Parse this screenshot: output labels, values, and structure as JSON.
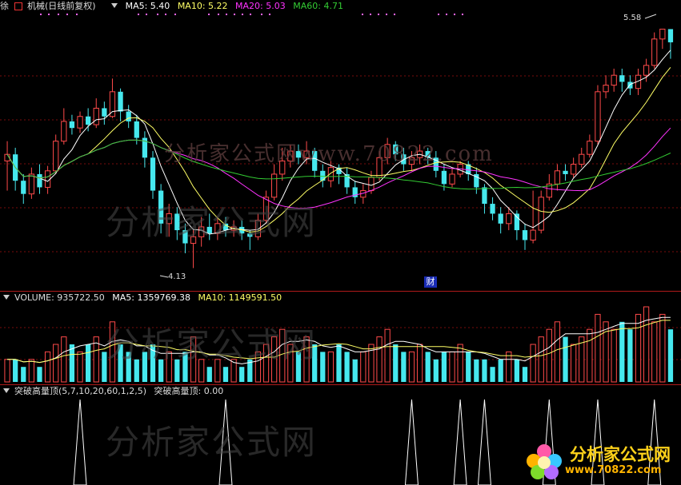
{
  "colors": {
    "up": "#ff4a4a",
    "down": "#46e8ee",
    "ma5": "#ffffff",
    "ma10": "#ffff66",
    "ma20": "#ff33ff",
    "ma60": "#33cc33",
    "grid": "#7a0d0d",
    "separator": "#b01a1a"
  },
  "price_panel": {
    "stock_name_pre": "徐",
    "stock_name_post": "机械(日线前复权)",
    "ma5": "MA5: 5.40",
    "ma10": "MA10: 5.22",
    "ma20": "MA20: 5.03",
    "ma60": "MA60: 4.71",
    "high_marker": "5.58",
    "low_marker": "4.13",
    "event_badge": "财"
  },
  "volume_panel": {
    "volume": "VOLUME: 935722.50",
    "ma5": "MA5: 1359769.38",
    "ma10": "MA10: 1149591.50"
  },
  "indicator_panel": {
    "formula": "突破高量顶(5,7,10,20,60,1,2,5)",
    "value": "突破高量顶: 0.00"
  },
  "watermarks": {
    "site_cn": "分析家公式网",
    "site_url_top": "分析家公式网www.70822.com",
    "logo_cn": "分析家公式网",
    "logo_url": "www.70822.com"
  },
  "chart_data": {
    "type": "candlestick",
    "price_axis_note": "low 4.13, high 5.58",
    "candles": [
      [
        4.78,
        4.82,
        4.6,
        4.9
      ],
      [
        4.82,
        4.66,
        4.6,
        4.86
      ],
      [
        4.66,
        4.58,
        4.52,
        4.7
      ],
      [
        4.58,
        4.7,
        4.55,
        4.74
      ],
      [
        4.7,
        4.62,
        4.58,
        4.76
      ],
      [
        4.62,
        4.72,
        4.58,
        4.75
      ],
      [
        4.72,
        4.9,
        4.7,
        4.94
      ],
      [
        4.9,
        5.02,
        4.88,
        5.1
      ],
      [
        5.02,
        4.98,
        4.94,
        5.06
      ],
      [
        4.98,
        5.05,
        4.95,
        5.08
      ],
      [
        5.05,
        5.0,
        4.96,
        5.1
      ],
      [
        5.0,
        5.1,
        4.98,
        5.16
      ],
      [
        5.1,
        5.05,
        5.0,
        5.14
      ],
      [
        5.05,
        5.2,
        5.04,
        5.28
      ],
      [
        5.2,
        5.08,
        5.02,
        5.22
      ],
      [
        5.08,
        5.02,
        4.98,
        5.12
      ],
      [
        5.02,
        4.92,
        4.88,
        5.06
      ],
      [
        4.92,
        4.8,
        4.74,
        4.96
      ],
      [
        4.8,
        4.6,
        4.55,
        4.84
      ],
      [
        4.6,
        4.4,
        4.34,
        4.64
      ],
      [
        4.4,
        4.46,
        4.32,
        4.52
      ],
      [
        4.46,
        4.36,
        4.3,
        4.5
      ],
      [
        4.36,
        4.28,
        4.22,
        4.4
      ],
      [
        4.28,
        4.32,
        4.13,
        4.36
      ],
      [
        4.32,
        4.38,
        4.26,
        4.44
      ],
      [
        4.38,
        4.34,
        4.3,
        4.46
      ],
      [
        4.34,
        4.4,
        4.3,
        4.44
      ],
      [
        4.4,
        4.36,
        4.32,
        4.44
      ],
      [
        4.36,
        4.38,
        4.32,
        4.42
      ],
      [
        4.38,
        4.34,
        4.3,
        4.42
      ],
      [
        4.34,
        4.32,
        4.24,
        4.36
      ],
      [
        4.32,
        4.42,
        4.3,
        4.46
      ],
      [
        4.42,
        4.56,
        4.4,
        4.6
      ],
      [
        4.56,
        4.7,
        4.54,
        4.76
      ],
      [
        4.7,
        4.78,
        4.66,
        4.86
      ],
      [
        4.78,
        4.84,
        4.74,
        4.88
      ],
      [
        4.84,
        4.8,
        4.76,
        4.88
      ],
      [
        4.8,
        4.84,
        4.76,
        4.9
      ],
      [
        4.84,
        4.72,
        4.68,
        4.86
      ],
      [
        4.72,
        4.66,
        4.62,
        4.76
      ],
      [
        4.66,
        4.74,
        4.62,
        4.78
      ],
      [
        4.74,
        4.7,
        4.64,
        4.76
      ],
      [
        4.7,
        4.62,
        4.58,
        4.74
      ],
      [
        4.62,
        4.56,
        4.52,
        4.66
      ],
      [
        4.56,
        4.6,
        4.52,
        4.64
      ],
      [
        4.6,
        4.68,
        4.58,
        4.72
      ],
      [
        4.68,
        4.8,
        4.66,
        4.84
      ],
      [
        4.8,
        4.88,
        4.76,
        4.92
      ],
      [
        4.88,
        4.82,
        4.78,
        4.9
      ],
      [
        4.82,
        4.76,
        4.72,
        4.86
      ],
      [
        4.76,
        4.8,
        4.72,
        4.84
      ],
      [
        4.8,
        4.84,
        4.76,
        4.88
      ],
      [
        4.84,
        4.8,
        4.76,
        4.86
      ],
      [
        4.8,
        4.72,
        4.68,
        4.84
      ],
      [
        4.72,
        4.64,
        4.6,
        4.76
      ],
      [
        4.64,
        4.7,
        4.62,
        4.74
      ],
      [
        4.7,
        4.76,
        4.68,
        4.78
      ],
      [
        4.76,
        4.7,
        4.66,
        4.78
      ],
      [
        4.7,
        4.62,
        4.58,
        4.74
      ],
      [
        4.62,
        4.52,
        4.46,
        4.64
      ],
      [
        4.52,
        4.46,
        4.42,
        4.56
      ],
      [
        4.46,
        4.4,
        4.34,
        4.5
      ],
      [
        4.4,
        4.46,
        4.36,
        4.5
      ],
      [
        4.46,
        4.36,
        4.3,
        4.48
      ],
      [
        4.36,
        4.3,
        4.24,
        4.4
      ],
      [
        4.3,
        4.36,
        4.28,
        4.6
      ],
      [
        4.36,
        4.56,
        4.34,
        4.6
      ],
      [
        4.56,
        4.64,
        4.54,
        4.7
      ],
      [
        4.64,
        4.72,
        4.6,
        4.76
      ],
      [
        4.72,
        4.7,
        4.66,
        4.76
      ],
      [
        4.7,
        4.76,
        4.68,
        4.8
      ],
      [
        4.76,
        4.82,
        4.74,
        4.86
      ],
      [
        4.82,
        4.9,
        4.8,
        4.94
      ],
      [
        4.9,
        5.2,
        4.88,
        5.24
      ],
      [
        5.2,
        5.24,
        5.16,
        5.3
      ],
      [
        5.24,
        5.3,
        5.2,
        5.34
      ],
      [
        5.3,
        5.26,
        5.2,
        5.34
      ],
      [
        5.26,
        5.22,
        5.18,
        5.3
      ],
      [
        5.22,
        5.3,
        5.18,
        5.34
      ],
      [
        5.3,
        5.36,
        5.26,
        5.4
      ],
      [
        5.36,
        5.52,
        5.34,
        5.56
      ],
      [
        5.52,
        5.58,
        5.46,
        5.58
      ],
      [
        5.58,
        5.5,
        5.4,
        5.58
      ]
    ],
    "volume": [
      3,
      3,
      2,
      3,
      2,
      4,
      5,
      6,
      5,
      4,
      5,
      6,
      4,
      8,
      5,
      4,
      3,
      4,
      5,
      3,
      4,
      3,
      4,
      6,
      3,
      2,
      3,
      2,
      3,
      2,
      3,
      4,
      5,
      6,
      7,
      5,
      4,
      6,
      5,
      4,
      4,
      5,
      4,
      3,
      4,
      5,
      6,
      7,
      5,
      4,
      4,
      5,
      4,
      3,
      4,
      4,
      5,
      4,
      3,
      3,
      2,
      3,
      4,
      3,
      2,
      5,
      6,
      7,
      8,
      6,
      5,
      6,
      7,
      9,
      8,
      7,
      8,
      7,
      9,
      10,
      8,
      9,
      7
    ],
    "signal_indexes": [
      9,
      27,
      50,
      56,
      59,
      67,
      73,
      80
    ]
  }
}
